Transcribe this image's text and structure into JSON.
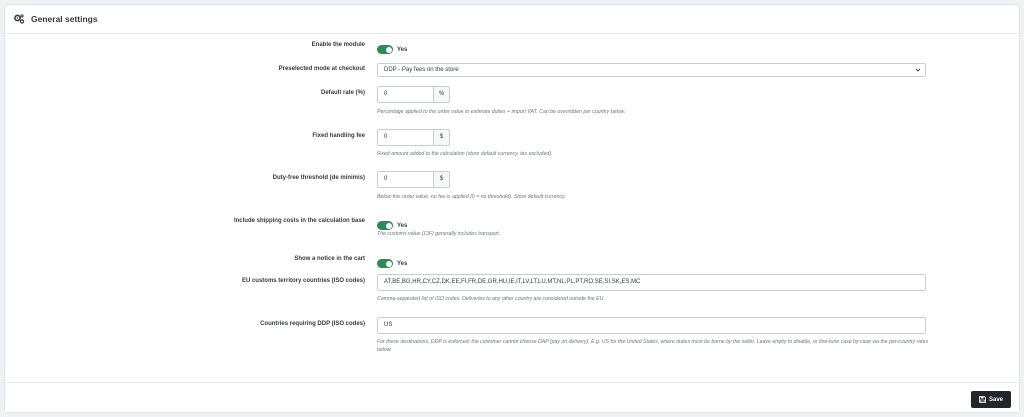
{
  "panel": {
    "title": "General settings",
    "title_icon": "gears-icon"
  },
  "fields": {
    "enable_module": {
      "label": "Enable the module",
      "toggle": "Yes"
    },
    "preselected_mode": {
      "label": "Preselected mode at checkout",
      "value": "DDP - Pay fees on the store"
    },
    "default_rate": {
      "label": "Default rate (%)",
      "value": "0",
      "addon": "%",
      "help": "Percentage applied to the order value to estimate duties + import VAT. Can be overridden per country below."
    },
    "fixed_fee": {
      "label": "Fixed handling fee",
      "value": "0",
      "addon": "$",
      "help": "Fixed amount added to the calculation (store default currency, tax excluded)."
    },
    "threshold": {
      "label": "Duty-free threshold (de minimis)",
      "value": "0",
      "addon": "$",
      "help": "Below this order value, no fee is applied (0 = no threshold). Store default currency."
    },
    "include_shipping": {
      "label": "Include shipping costs in the calculation base",
      "toggle": "Yes",
      "help": "The customs value (CIF) generally includes transport."
    },
    "show_notice": {
      "label": "Show a notice in the cart",
      "toggle": "Yes"
    },
    "eu_countries": {
      "label": "EU customs territory countries (ISO codes)",
      "value": "AT,BE,BG,HR,CY,CZ,DK,EE,FI,FR,DE,GR,HU,IE,IT,LV,LT,LU,MT,NL,PL,PT,RO,SE,SI,SK,ES,MC",
      "help": "Comma-separated list of ISO codes. Deliveries to any other country are considered outside the EU."
    },
    "ddp_countries": {
      "label": "Countries requiring DDP (ISO codes)",
      "value": "US",
      "help": "For these destinations, DDP is enforced: the customer cannot choose DAP (pay on delivery). E.g. US for the United States, where duties must be borne by the seller. Leave empty to disable, or fine-tune case by case via the per-country rates below."
    }
  },
  "footer": {
    "save_label": "Save"
  },
  "colors": {
    "toggle_on": "#2e8b57",
    "save_bg": "#25262b"
  }
}
